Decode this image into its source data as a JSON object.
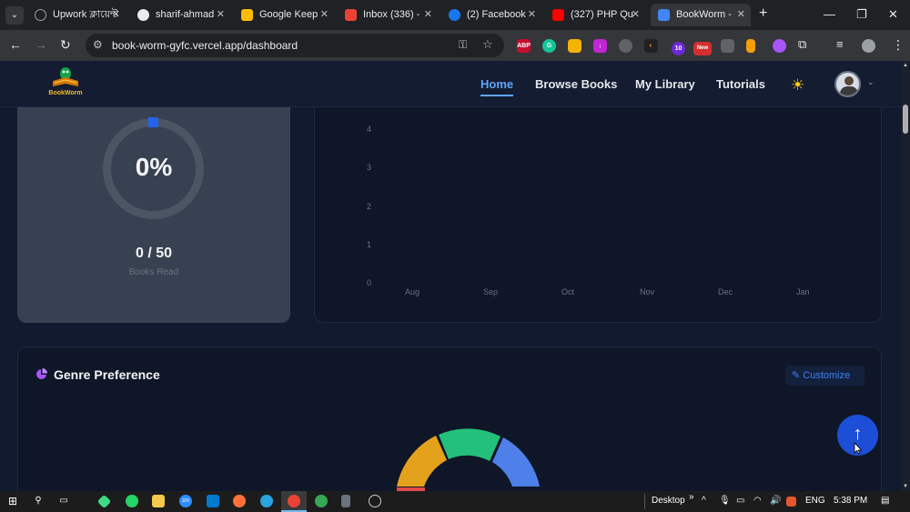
{
  "browser": {
    "tabs": [
      {
        "label": "Upwork ক্লায়েন্ট",
        "favicon_color": "#9aa0a6"
      },
      {
        "label": "sharif-ahmad",
        "favicon_color": "#e8eaed"
      },
      {
        "label": "Google Keep",
        "favicon_color": "#fbbc04"
      },
      {
        "label": "Inbox (336) -",
        "favicon_color": "#ea4335"
      },
      {
        "label": "(2) Facebook",
        "favicon_color": "#1877f2"
      },
      {
        "label": "(327) PHP Qu",
        "favicon_color": "#ff0000"
      },
      {
        "label": "BookWorm -",
        "favicon_color": "#4285f4"
      }
    ],
    "tab_close": "✕",
    "new_tab": "+",
    "url": "book-worm-gyfc.vercel.app/dashboard",
    "window_controls": [
      "—",
      "❐",
      "✕"
    ],
    "extensions": [
      {
        "label": "ABP",
        "color": "#c70d2c"
      },
      {
        "label": "G",
        "color": "#15c39a"
      },
      {
        "label": "",
        "color": "#f4b400"
      },
      {
        "label": "↓",
        "color": "#c026d3"
      },
      {
        "label": "",
        "color": "#5f6368"
      },
      {
        "label": "",
        "color": "#ff9800"
      },
      {
        "label": "10",
        "color": "#6d28d9"
      },
      {
        "label": "New",
        "color": "#d32f2f"
      },
      {
        "label": "",
        "color": "#5f6368"
      },
      {
        "label": "",
        "color": "#f59e0b"
      },
      {
        "label": "",
        "color": "#a855f7"
      }
    ]
  },
  "app": {
    "logo_text": "BookWorm",
    "nav": [
      {
        "label": "Home",
        "active": true
      },
      {
        "label": "Browse Books",
        "active": false
      },
      {
        "label": "My Library",
        "active": false
      },
      {
        "label": "Tutorials",
        "active": false
      }
    ]
  },
  "reading_goal": {
    "progress_percent_label": "0%",
    "progress_fraction": 0,
    "count_label": "0 / 50",
    "sub_label": "Books Read"
  },
  "chart_data": {
    "type": "line",
    "x": [
      "Aug",
      "Sep",
      "Oct",
      "Nov",
      "Dec",
      "Jan"
    ],
    "y_ticks": [
      0,
      1,
      2,
      3,
      4
    ],
    "ylim": [
      0,
      4
    ],
    "series": [
      {
        "values": [
          0,
          0,
          0,
          0,
          0,
          0
        ]
      }
    ],
    "grid": false
  },
  "genre": {
    "title": "Genre Preference",
    "customize_label": "Customize",
    "segment_colors": [
      "#e4a11b",
      "#22c07a",
      "#4f7fe8",
      "#e14b4b"
    ]
  },
  "taskbar": {
    "desktop_label": "Desktop",
    "lang": "ENG",
    "time": "5:38 PM"
  },
  "colors": {
    "accent": "#60a5fa",
    "page_bg": "#111a2e",
    "card": "#374151",
    "fab": "#1d4ed8"
  }
}
